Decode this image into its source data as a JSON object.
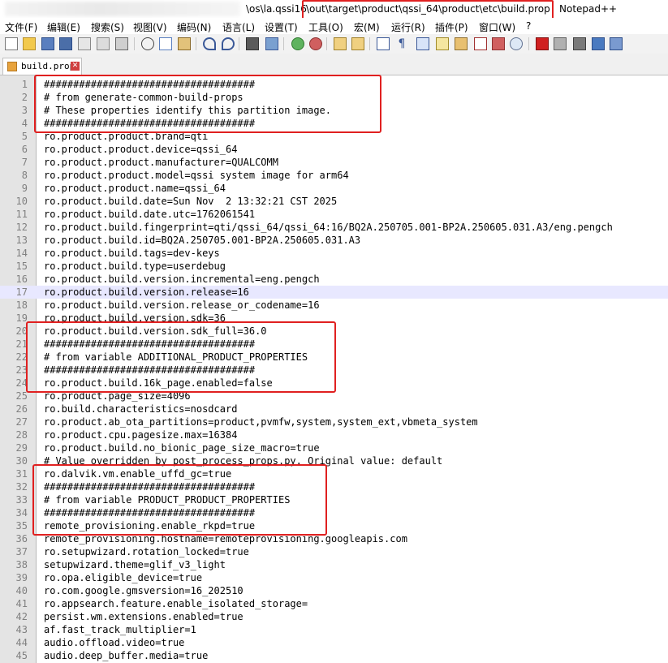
{
  "title": {
    "path_prefix": "\\os\\la.qssi16",
    "path_highlight": "\\out\\target\\product\\qssi_64\\product\\etc\\build.prop",
    "app_name": "Notepad++"
  },
  "menu": [
    "文件(F)",
    "编辑(E)",
    "搜索(S)",
    "视图(V)",
    "编码(N)",
    "语言(L)",
    "设置(T)",
    "工具(O)",
    "宏(M)",
    "运行(R)",
    "插件(P)",
    "窗口(W)",
    "?"
  ],
  "toolbar_icons": [
    "new-file-icon",
    "open-file-icon",
    "save-icon",
    "save-all-icon",
    "close-icon",
    "close-all-icon",
    "print-icon",
    "cut-icon",
    "copy-icon",
    "paste-icon",
    "undo-icon",
    "redo-icon",
    "find-icon",
    "replace-icon",
    "zoom-in-icon",
    "zoom-out-icon",
    "sync-vertical-icon",
    "sync-horizontal-icon",
    "word-wrap-icon",
    "show-all-chars-icon",
    "indent-guide-icon",
    "udl-icon",
    "doc-map-icon",
    "function-list-icon",
    "folder-workspace-icon",
    "monitor-icon",
    "record-macro-icon",
    "stop-macro-icon",
    "play-macro-icon",
    "run-macro-multiple-icon",
    "save-macro-icon"
  ],
  "tab": {
    "label": "build.prop"
  },
  "current_line": 17,
  "lines": [
    "####################################",
    "# from generate-common-build-props",
    "# These properties identify this partition image.",
    "####################################",
    "ro.product.product.brand=qti",
    "ro.product.product.device=qssi_64",
    "ro.product.product.manufacturer=QUALCOMM",
    "ro.product.product.model=qssi system image for arm64",
    "ro.product.product.name=qssi_64",
    "ro.product.build.date=Sun Nov  2 13:32:21 CST 2025",
    "ro.product.build.date.utc=1762061541",
    "ro.product.build.fingerprint=qti/qssi_64/qssi_64:16/BQ2A.250705.001-BP2A.250605.031.A3/eng.pengch",
    "ro.product.build.id=BQ2A.250705.001-BP2A.250605.031.A3",
    "ro.product.build.tags=dev-keys",
    "ro.product.build.type=userdebug",
    "ro.product.build.version.incremental=eng.pengch",
    "ro.product.build.version.release=16",
    "ro.product.build.version.release_or_codename=16",
    "ro.product.build.version.sdk=36",
    "ro.product.build.version.sdk_full=36.0",
    "####################################",
    "# from variable ADDITIONAL_PRODUCT_PROPERTIES",
    "####################################",
    "ro.product.build.16k_page.enabled=false",
    "ro.product.page_size=4096",
    "ro.build.characteristics=nosdcard",
    "ro.product.ab_ota_partitions=product,pvmfw,system,system_ext,vbmeta_system",
    "ro.product.cpu.pagesize.max=16384",
    "ro.product.build.no_bionic_page_size_macro=true",
    "# Value overridden by post_process_props.py. Original value: default",
    "ro.dalvik.vm.enable_uffd_gc=true",
    "####################################",
    "# from variable PRODUCT_PRODUCT_PROPERTIES",
    "####################################",
    "remote_provisioning.enable_rkpd=true",
    "remote_provisioning.hostname=remoteprovisioning.googleapis.com",
    "ro.setupwizard.rotation_locked=true",
    "setupwizard.theme=glif_v3_light",
    "ro.opa.eligible_device=true",
    "ro.com.google.gmsversion=16_202510",
    "ro.appsearch.feature.enable_isolated_storage=",
    "persist.wm.extensions.enabled=true",
    "af.fast_track_multiplier=1",
    "audio.offload.video=true",
    "audio.deep_buffer.media=true"
  ],
  "highlight_line_ranges": [
    [
      1,
      4
    ],
    [
      20,
      24
    ],
    [
      31,
      35
    ]
  ]
}
